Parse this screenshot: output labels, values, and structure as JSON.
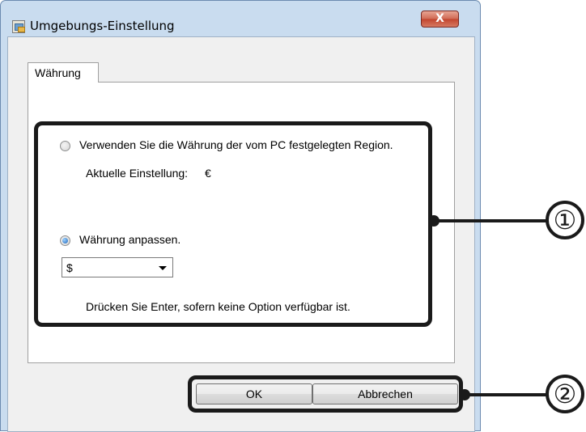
{
  "window": {
    "title": "Umgebungs-Einstellung",
    "close_label": "X"
  },
  "tabs": [
    {
      "label": "Währung",
      "active": true
    }
  ],
  "options": {
    "region": {
      "label": "Verwenden Sie die Währung der vom PC festgelegten Region.",
      "checked": false,
      "current_label": "Aktuelle Einstellung:",
      "current_value": "€"
    },
    "custom": {
      "label": "Währung anpassen.",
      "checked": true,
      "selected_value": "$",
      "hint": "Drücken Sie Enter, sofern keine Option verfügbar ist."
    }
  },
  "buttons": {
    "ok": "OK",
    "cancel": "Abbrechen"
  },
  "callouts": [
    {
      "number": "①"
    },
    {
      "number": "②"
    }
  ]
}
